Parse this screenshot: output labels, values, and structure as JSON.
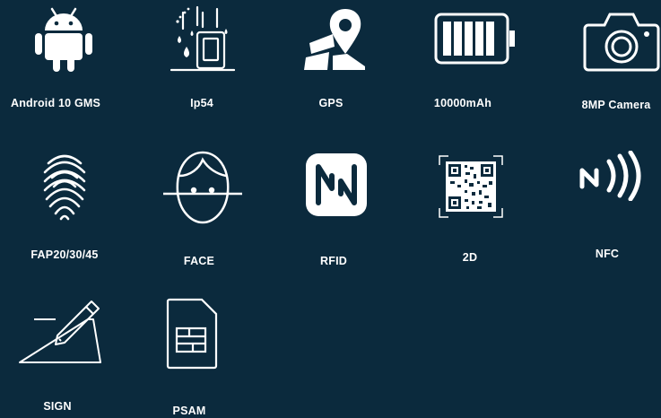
{
  "features": [
    {
      "label": "Android 10  GMS",
      "icon": "android-icon"
    },
    {
      "label": "Ip54",
      "icon": "waterproof-phone-icon"
    },
    {
      "label": "GPS",
      "icon": "map-pin-icon"
    },
    {
      "label": "10000mAh",
      "icon": "battery-icon"
    },
    {
      "label": "8MP Camera",
      "icon": "camera-icon"
    },
    {
      "label": "FAP20/30/45",
      "icon": "fingerprint-icon"
    },
    {
      "label": "FACE",
      "icon": "face-scan-icon"
    },
    {
      "label": "RFID",
      "icon": "rfid-n-icon"
    },
    {
      "label": "2D",
      "icon": "qr-code-icon"
    },
    {
      "label": "NFC",
      "icon": "nfc-icon"
    },
    {
      "label": "SIGN",
      "icon": "signature-pen-icon"
    },
    {
      "label": "PSAM",
      "icon": "sim-card-icon"
    }
  ],
  "colors": {
    "background": "#0b2a3d",
    "foreground": "#ffffff"
  }
}
